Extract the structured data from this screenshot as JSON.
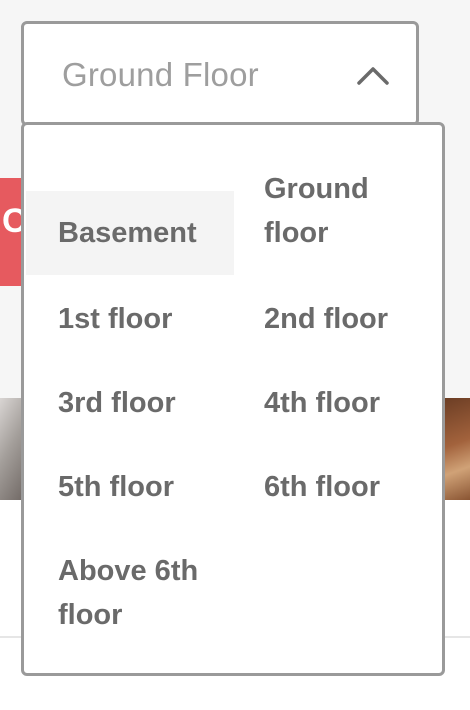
{
  "background": {
    "red_banner_partial_text": "C"
  },
  "select": {
    "value": "Ground Floor",
    "chevron_icon": "chevron-up-icon"
  },
  "options": [
    {
      "label": "Basement",
      "selected": true
    },
    {
      "label": "Ground floor",
      "selected": false
    },
    {
      "label": "1st floor",
      "selected": false
    },
    {
      "label": "2nd floor",
      "selected": false
    },
    {
      "label": "3rd floor",
      "selected": false
    },
    {
      "label": "4th floor",
      "selected": false
    },
    {
      "label": "5th floor",
      "selected": false
    },
    {
      "label": "6th floor",
      "selected": false
    },
    {
      "label": "Above 6th floor",
      "selected": false
    }
  ],
  "colors": {
    "border": "#9a9a9a",
    "text": "#6a6a6a",
    "placeholder_text": "#9e9e9e",
    "selected_option_bg": "#f4f4f4",
    "red_banner": "#e65a5f"
  }
}
